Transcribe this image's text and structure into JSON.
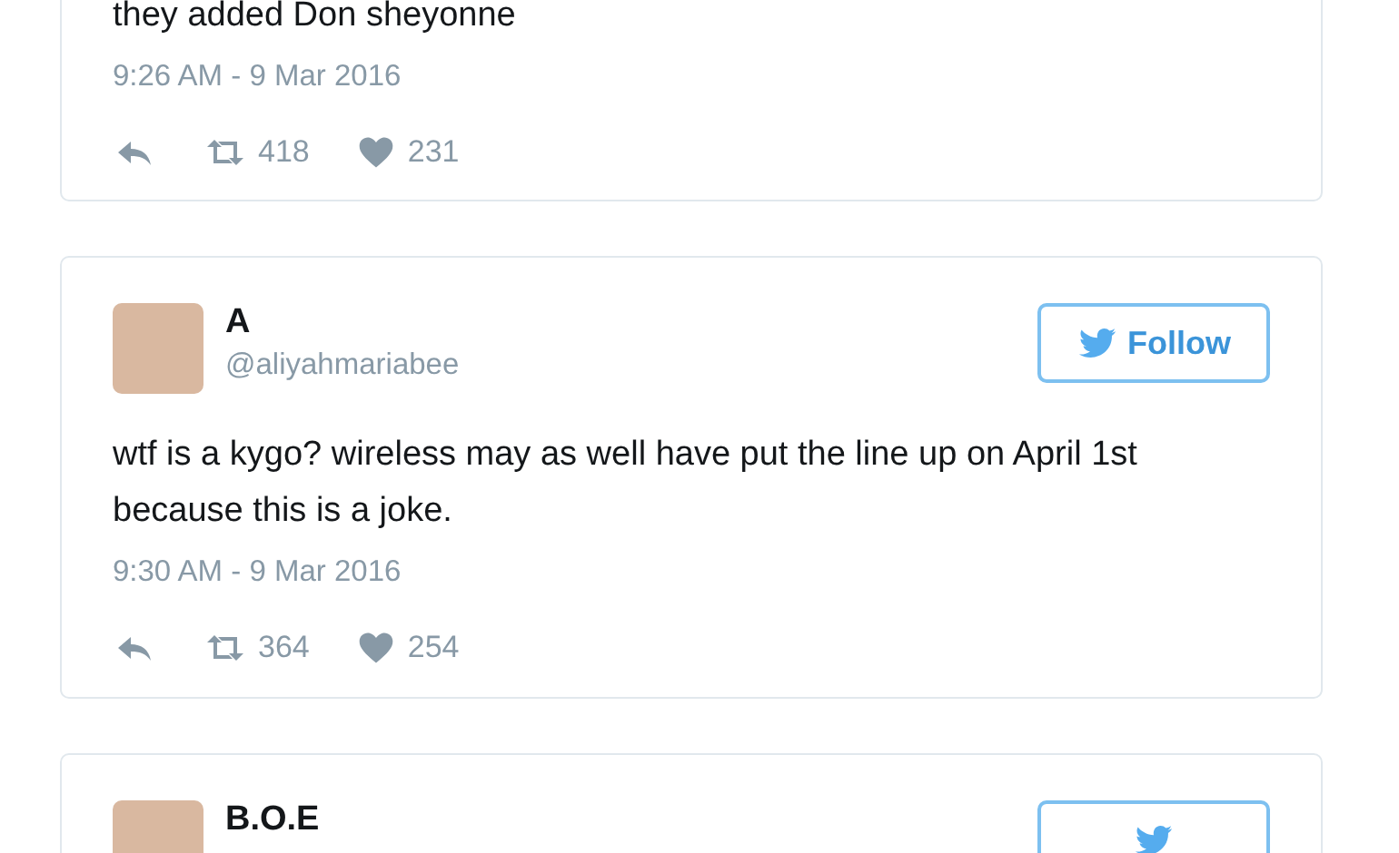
{
  "tweets": [
    {
      "text": "they added Don sheyonne",
      "time": "9:26 AM - 9 Mar 2016",
      "retweets": "418",
      "likes": "231"
    },
    {
      "name": "A",
      "handle": "@aliyahmariabee",
      "follow_button": true,
      "follow": "Follow",
      "text": "wtf is a kygo? wireless may as well have put the line up on April 1st because this is a joke.",
      "time": "9:30 AM - 9 Mar 2016",
      "retweets": "364",
      "likes": "254"
    },
    {
      "name": "B.O.E",
      "follow_button": true
    }
  ]
}
